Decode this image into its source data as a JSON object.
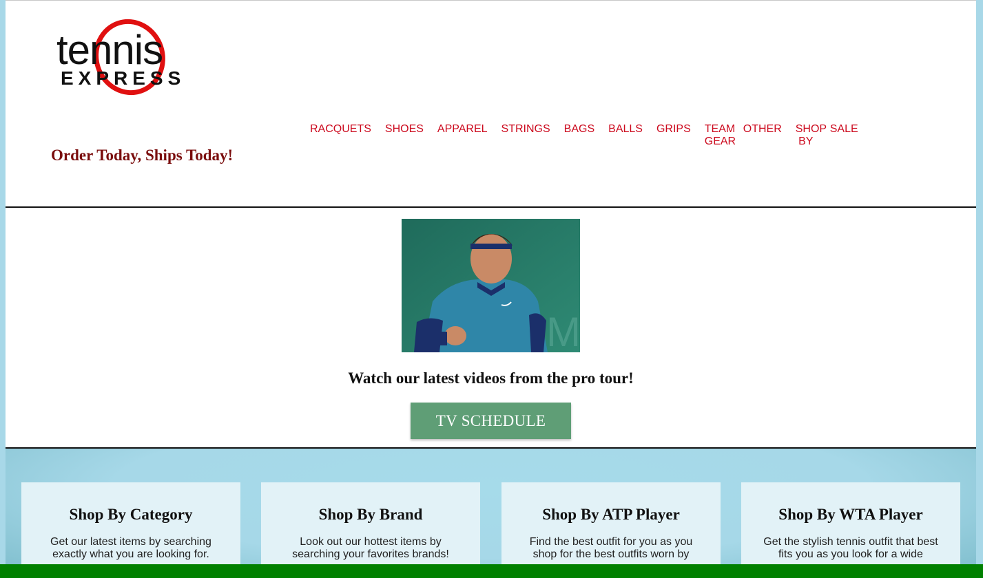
{
  "header": {
    "logo": {
      "word_top": "tennis",
      "word_bottom": "EXPRESS"
    },
    "tagline": "Order Today, Ships Today!"
  },
  "nav": {
    "items": [
      "RACQUETS",
      "SHOES",
      "APPAREL",
      "STRINGS",
      "BAGS",
      "BALLS",
      "GRIPS",
      "TEAM GEAR",
      "OTHER",
      "SHOP BY",
      "SALE"
    ]
  },
  "hero": {
    "caption": "Watch our latest videos from the pro tour!",
    "button_label": "TV SCHEDULE"
  },
  "shop": {
    "cards": [
      {
        "title": "Shop By Category",
        "text": "Get our latest items by searching exactly what you are looking for."
      },
      {
        "title": "Shop By Brand",
        "text": "Look out our hottest items by searching your favorites brands!"
      },
      {
        "title": "Shop By ATP Player",
        "text": "Find the best outfit for you as you shop for the best outfits worn by"
      },
      {
        "title": "Shop By WTA Player",
        "text": "Get the stylish tennis outfit that best fits you as you look for a wide"
      }
    ]
  },
  "colors": {
    "nav_red": "#cc0a1e",
    "tagline_maroon": "#7a0d0d",
    "button_green": "#5f9e76",
    "section_blue": "#a6dbea",
    "bottom_bar_green": "#008000"
  }
}
